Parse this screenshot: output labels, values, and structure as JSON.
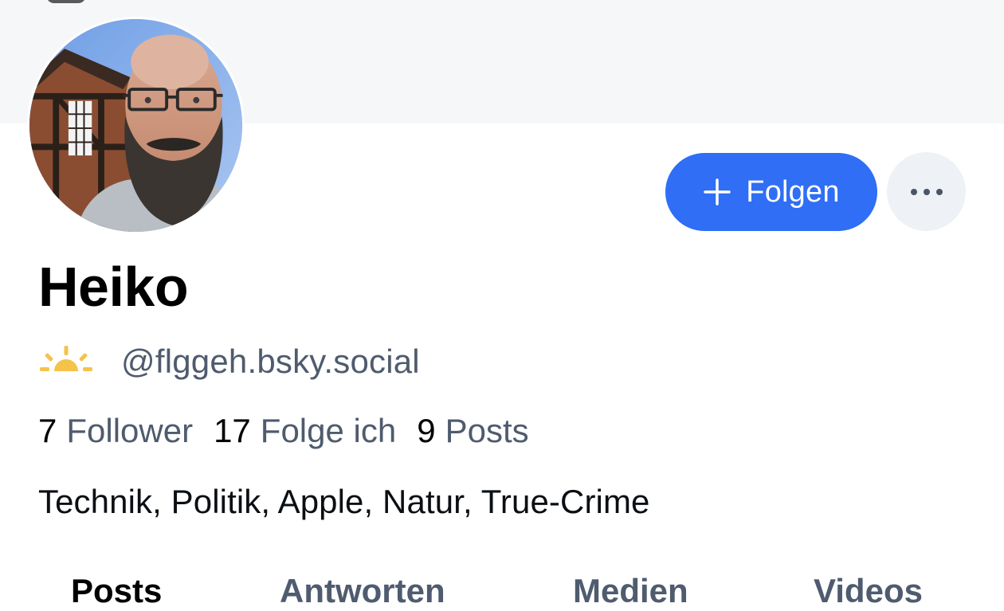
{
  "profile": {
    "display_name": "Heiko",
    "handle": "@flggeh.bsky.social",
    "bio": "Technik, Politik, Apple, Natur, True-Crime",
    "avatar_icon": "profile-photo",
    "handle_icon": "sunrise-icon"
  },
  "actions": {
    "follow_label": "Folgen",
    "follow_icon": "plus-icon",
    "more_icon": "more-horizontal-icon",
    "accent_color": "#2f6ef5"
  },
  "stats": {
    "followers": {
      "count": "7",
      "label": "Follower"
    },
    "following": {
      "count": "17",
      "label": "Folge ich"
    },
    "posts": {
      "count": "9",
      "label": "Posts"
    }
  },
  "tabs": [
    {
      "label": "Posts",
      "active": true
    },
    {
      "label": "Antworten",
      "active": false
    },
    {
      "label": "Medien",
      "active": false
    },
    {
      "label": "Videos",
      "active": false
    }
  ]
}
